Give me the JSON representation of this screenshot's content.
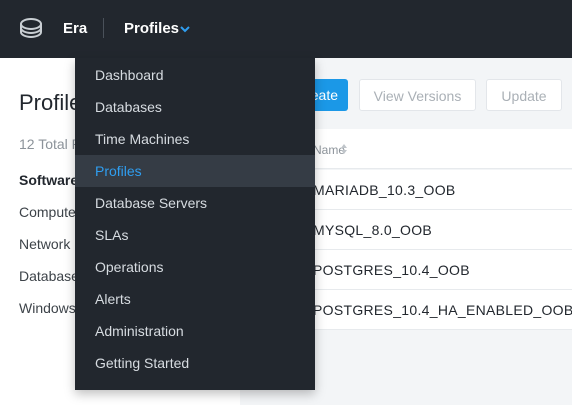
{
  "topbar": {
    "app_name": "Era",
    "current_section": "Profiles",
    "logo_icon": "era-logo-icon",
    "chevron_icon": "chevron-down-icon",
    "accent_color": "#2f9ef0"
  },
  "page": {
    "title": "Profiles",
    "total": "12 Total Profiles"
  },
  "sidebar": {
    "items": [
      {
        "label": "Software",
        "active": true
      },
      {
        "label": "Compute",
        "active": false
      },
      {
        "label": "Network",
        "active": false
      },
      {
        "label": "Database",
        "active": false
      },
      {
        "label": "Windows",
        "active": false
      }
    ]
  },
  "toolbar": {
    "create_label": "Create",
    "view_versions_label": "View Versions",
    "update_label": "Update",
    "primary_color": "#1b98e7"
  },
  "table": {
    "name_header": "Name",
    "rows": [
      "MARIADB_10.3_OOB",
      "MYSQL_8.0_OOB",
      "POSTGRES_10.4_OOB",
      "POSTGRES_10.4_HA_ENABLED_OOB"
    ]
  },
  "menu": {
    "items": [
      {
        "label": "Dashboard",
        "active": false
      },
      {
        "label": "Databases",
        "active": false
      },
      {
        "label": "Time Machines",
        "active": false
      },
      {
        "label": "Profiles",
        "active": true
      },
      {
        "label": "Database Servers",
        "active": false
      },
      {
        "label": "SLAs",
        "active": false
      },
      {
        "label": "Operations",
        "active": false
      },
      {
        "label": "Alerts",
        "active": false
      },
      {
        "label": "Administration",
        "active": false
      },
      {
        "label": "Getting Started",
        "active": false
      }
    ]
  }
}
